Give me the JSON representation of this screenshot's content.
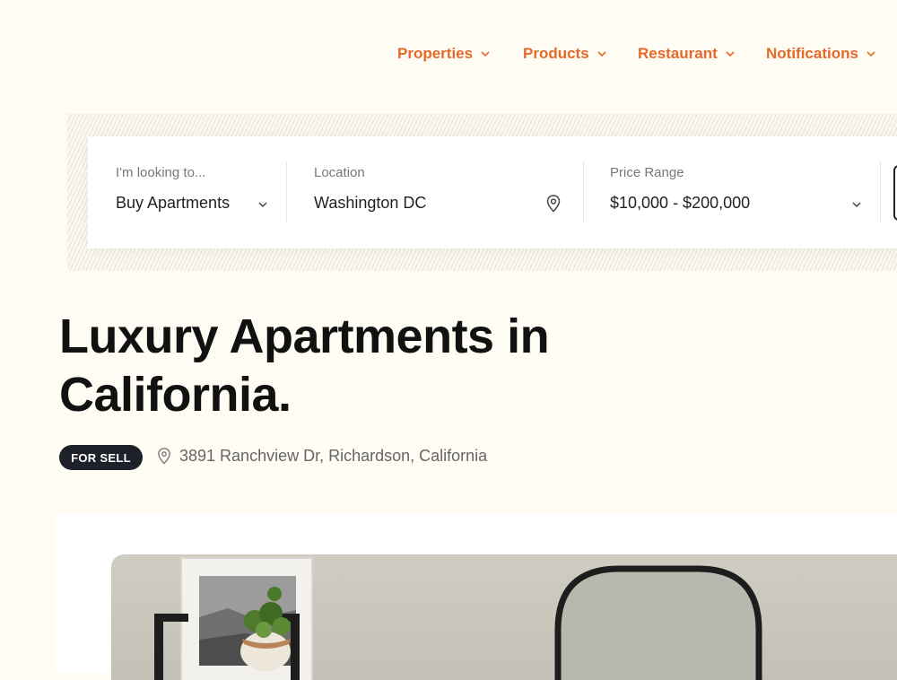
{
  "nav": {
    "items": [
      {
        "label": "Properties"
      },
      {
        "label": "Products"
      },
      {
        "label": "Restaurant"
      },
      {
        "label": "Notifications"
      }
    ]
  },
  "search": {
    "intent": {
      "label": "I'm looking to...",
      "value": "Buy Apartments",
      "icon": "chevron-down-icon"
    },
    "location": {
      "label": "Location",
      "value": "Washington DC",
      "icon": "map-pin-icon"
    },
    "price": {
      "label": "Price Range",
      "value": "$10,000 - $200,000",
      "icon": "chevron-down-icon"
    }
  },
  "listing": {
    "title": "Luxury Apartments in California.",
    "badge": "FOR SELL",
    "address": "3891 Ranchview Dr, Richardson, California"
  },
  "colors": {
    "accent": "#e4692a",
    "background": "#fffcf3",
    "badge": "#1e2129"
  }
}
